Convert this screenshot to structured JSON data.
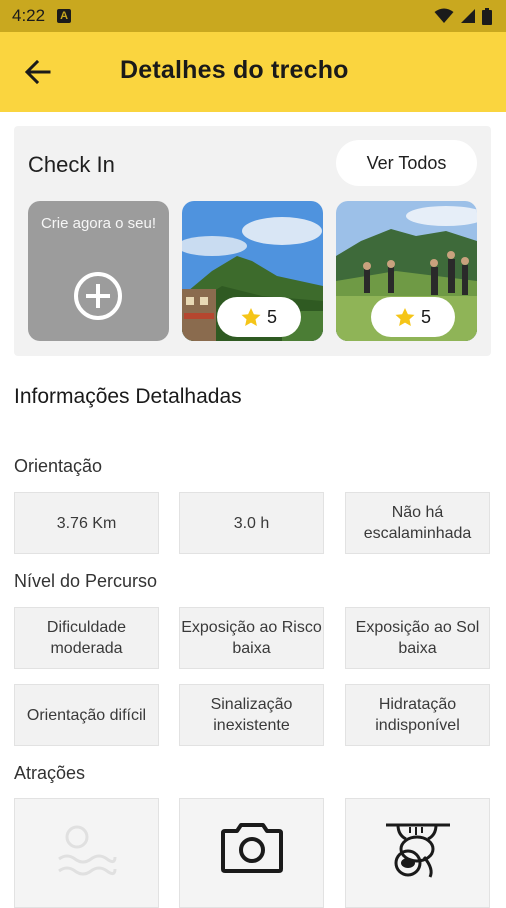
{
  "status_bar": {
    "time": "4:22",
    "notification_letter": "A"
  },
  "app_bar": {
    "title": "Detalhes do trecho"
  },
  "checkin": {
    "title": "Check In",
    "see_all_label": "Ver Todos",
    "create_label": "Crie agora o seu!",
    "photos": [
      {
        "rating": "5",
        "rating_icon": "star-icon"
      },
      {
        "rating": "5",
        "rating_icon": "star-icon"
      }
    ]
  },
  "details": {
    "title": "Informações Detalhadas",
    "orientation": {
      "title": "Orientação",
      "items": [
        "3.76 Km",
        "3.0 h",
        "Não há escalaminhada"
      ]
    },
    "level": {
      "title": "Nível do Percurso",
      "items": [
        "Dificuldade moderada",
        "Exposição ao Risco baixa",
        "Exposição ao Sol baixa",
        "Orientação difícil",
        "Sinalização inexistente",
        "Hidratação indisponível"
      ]
    },
    "attractions": {
      "title": "Atrações",
      "items": [
        {
          "icon": "water-icon",
          "label": ""
        },
        {
          "icon": "camera-icon",
          "label": ""
        },
        {
          "icon": "sloth-icon",
          "label": ""
        }
      ]
    }
  },
  "colors": {
    "app_bar": "#fad53f",
    "status_bar": "#c9a81f",
    "card_background": "#f2f2f2",
    "create_tile": "#9c9c9c",
    "star": "#f5c518"
  }
}
